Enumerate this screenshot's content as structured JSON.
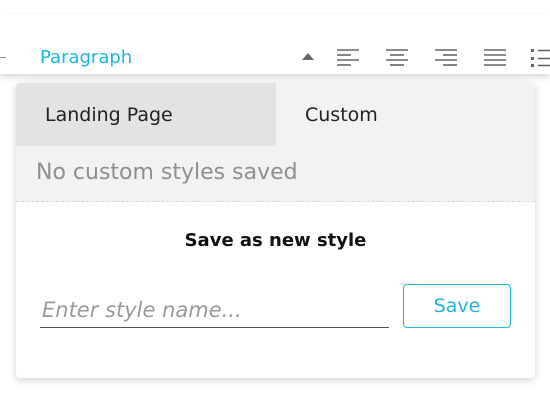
{
  "toolbar": {
    "block_format": "Paragraph",
    "caret_icon": "caret-up-icon",
    "align_icons": [
      "align-left-icon",
      "align-center-icon",
      "align-right-icon",
      "align-justify-icon",
      "bulleted-list-icon"
    ],
    "accent_color": "#1fb6dc"
  },
  "panel": {
    "tabs": [
      {
        "label": "Landing Page",
        "active": false
      },
      {
        "label": "Custom",
        "active": true
      }
    ],
    "empty_message": "No custom styles saved",
    "save_heading": "Save as new style",
    "name_input": {
      "placeholder": "Enter style name...",
      "value": ""
    },
    "save_label": "Save"
  }
}
